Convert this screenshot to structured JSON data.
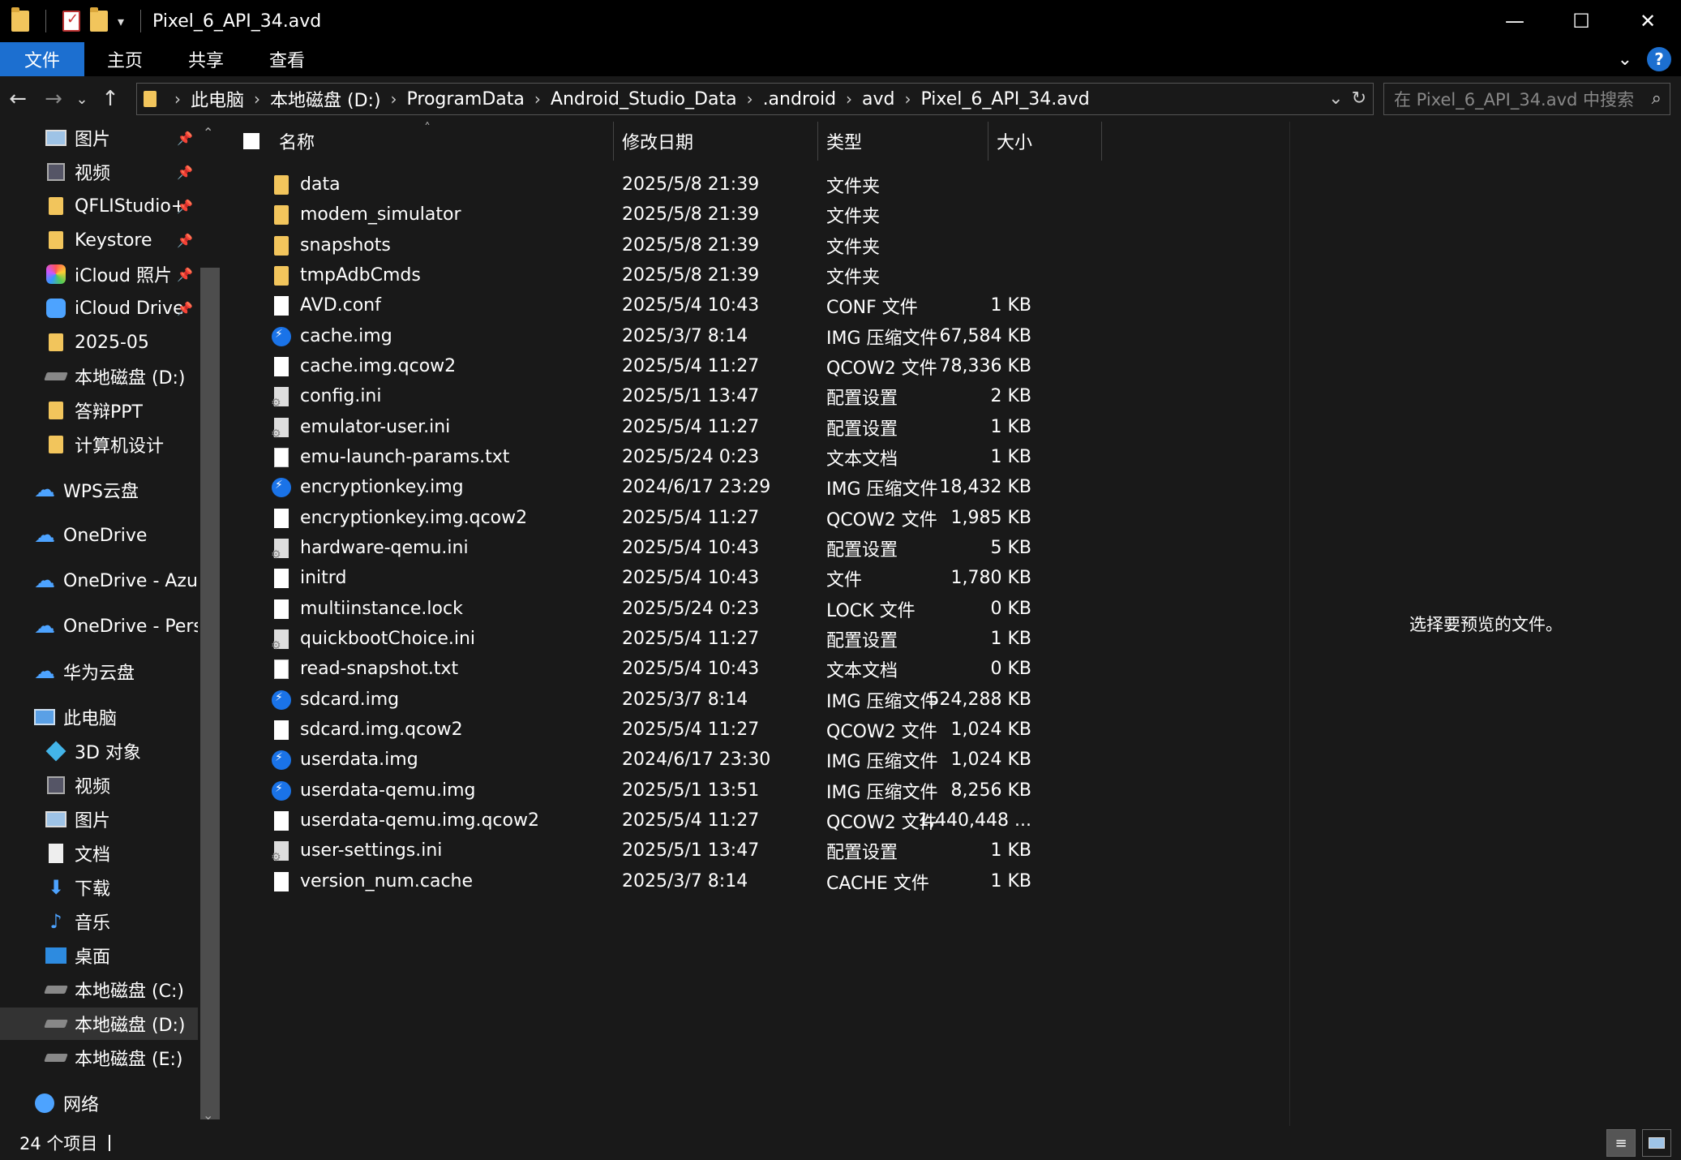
{
  "window": {
    "title": "Pixel_6_API_34.avd",
    "controls": {
      "minimize": "—",
      "maximize": "☐",
      "close": "✕"
    }
  },
  "ribbon": {
    "tabs": [
      {
        "label": "文件",
        "active": true
      },
      {
        "label": "主页",
        "active": false
      },
      {
        "label": "共享",
        "active": false
      },
      {
        "label": "查看",
        "active": false
      }
    ],
    "help": "?"
  },
  "address": {
    "breadcrumbs": [
      "此电脑",
      "本地磁盘 (D:)",
      "ProgramData",
      "Android_Studio_Data",
      ".android",
      "avd",
      "Pixel_6_API_34.avd"
    ]
  },
  "search": {
    "placeholder": "在 Pixel_6_API_34.avd 中搜索"
  },
  "nav": {
    "items": [
      {
        "label": "图片",
        "icon": "pictures-icon",
        "pinned": true
      },
      {
        "label": "视频",
        "icon": "video-icon",
        "pinned": true
      },
      {
        "label": "QFLIStudio+",
        "icon": "folder-icon",
        "pinned": true
      },
      {
        "label": "Keystore",
        "icon": "folder-icon",
        "pinned": true
      },
      {
        "label": "iCloud 照片",
        "icon": "icloud-photos-icon",
        "pinned": true
      },
      {
        "label": "iCloud Drive",
        "icon": "icloud-drive-icon",
        "pinned": true
      },
      {
        "label": "2025-05",
        "icon": "folder-icon",
        "pinned": false
      },
      {
        "label": "本地磁盘 (D:)",
        "icon": "drive-icon",
        "pinned": false
      },
      {
        "label": "答辩PPT",
        "icon": "folder-icon",
        "pinned": false
      },
      {
        "label": "计算机设计",
        "icon": "folder-icon",
        "pinned": false
      },
      {
        "label": "WPS云盘",
        "icon": "wps-cloud-icon",
        "pinned": false
      },
      {
        "label": "OneDrive",
        "icon": "onedrive-icon",
        "pinned": false
      },
      {
        "label": "OneDrive - Azure",
        "icon": "onedrive-icon",
        "pinned": false
      },
      {
        "label": "OneDrive - Perso",
        "icon": "onedrive-icon",
        "pinned": false
      },
      {
        "label": "华为云盘",
        "icon": "huawei-cloud-icon",
        "pinned": false
      },
      {
        "label": "此电脑",
        "icon": "this-pc-icon",
        "pinned": false
      },
      {
        "label": "3D 对象",
        "icon": "3d-objects-icon",
        "pinned": false
      },
      {
        "label": "视频",
        "icon": "video-icon",
        "pinned": false
      },
      {
        "label": "图片",
        "icon": "pictures-icon",
        "pinned": false
      },
      {
        "label": "文档",
        "icon": "documents-icon",
        "pinned": false
      },
      {
        "label": "下载",
        "icon": "download-icon",
        "pinned": false
      },
      {
        "label": "音乐",
        "icon": "music-icon",
        "pinned": false
      },
      {
        "label": "桌面",
        "icon": "desktop-icon",
        "pinned": false
      },
      {
        "label": "本地磁盘 (C:)",
        "icon": "drive-icon",
        "pinned": false
      },
      {
        "label": "本地磁盘 (D:)",
        "icon": "drive-icon",
        "pinned": false,
        "selected": true
      },
      {
        "label": "本地磁盘 (E:)",
        "icon": "drive-icon",
        "pinned": false
      },
      {
        "label": "网络",
        "icon": "network-icon",
        "pinned": false
      }
    ]
  },
  "columns": {
    "name": "名称",
    "date": "修改日期",
    "type": "类型",
    "size": "大小"
  },
  "files": [
    {
      "name": "data",
      "date": "2025/5/8 21:39",
      "type": "文件夹",
      "size": "",
      "icon": "folder"
    },
    {
      "name": "modem_simulator",
      "date": "2025/5/8 21:39",
      "type": "文件夹",
      "size": "",
      "icon": "folder"
    },
    {
      "name": "snapshots",
      "date": "2025/5/8 21:39",
      "type": "文件夹",
      "size": "",
      "icon": "folder"
    },
    {
      "name": "tmpAdbCmds",
      "date": "2025/5/8 21:39",
      "type": "文件夹",
      "size": "",
      "icon": "folder"
    },
    {
      "name": "AVD.conf",
      "date": "2025/5/4 10:43",
      "type": "CONF 文件",
      "size": "1 KB",
      "icon": "file"
    },
    {
      "name": "cache.img",
      "date": "2025/3/7 8:14",
      "type": "IMG 压缩文件",
      "size": "67,584 KB",
      "icon": "img"
    },
    {
      "name": "cache.img.qcow2",
      "date": "2025/5/4 11:27",
      "type": "QCOW2 文件",
      "size": "78,336 KB",
      "icon": "file"
    },
    {
      "name": "config.ini",
      "date": "2025/5/1 13:47",
      "type": "配置设置",
      "size": "2 KB",
      "icon": "ini"
    },
    {
      "name": "emulator-user.ini",
      "date": "2025/5/4 11:27",
      "type": "配置设置",
      "size": "1 KB",
      "icon": "ini"
    },
    {
      "name": "emu-launch-params.txt",
      "date": "2025/5/24 0:23",
      "type": "文本文档",
      "size": "1 KB",
      "icon": "txt"
    },
    {
      "name": "encryptionkey.img",
      "date": "2024/6/17 23:29",
      "type": "IMG 压缩文件",
      "size": "18,432 KB",
      "icon": "img"
    },
    {
      "name": "encryptionkey.img.qcow2",
      "date": "2025/5/4 11:27",
      "type": "QCOW2 文件",
      "size": "1,985 KB",
      "icon": "file"
    },
    {
      "name": "hardware-qemu.ini",
      "date": "2025/5/4 10:43",
      "type": "配置设置",
      "size": "5 KB",
      "icon": "ini"
    },
    {
      "name": "initrd",
      "date": "2025/5/4 10:43",
      "type": "文件",
      "size": "1,780 KB",
      "icon": "file"
    },
    {
      "name": "multiinstance.lock",
      "date": "2025/5/24 0:23",
      "type": "LOCK 文件",
      "size": "0 KB",
      "icon": "file"
    },
    {
      "name": "quickbootChoice.ini",
      "date": "2025/5/4 11:27",
      "type": "配置设置",
      "size": "1 KB",
      "icon": "ini"
    },
    {
      "name": "read-snapshot.txt",
      "date": "2025/5/4 10:43",
      "type": "文本文档",
      "size": "0 KB",
      "icon": "txt"
    },
    {
      "name": "sdcard.img",
      "date": "2025/3/7 8:14",
      "type": "IMG 压缩文件",
      "size": "524,288 KB",
      "icon": "img"
    },
    {
      "name": "sdcard.img.qcow2",
      "date": "2025/5/4 11:27",
      "type": "QCOW2 文件",
      "size": "1,024 KB",
      "icon": "file"
    },
    {
      "name": "userdata.img",
      "date": "2024/6/17 23:30",
      "type": "IMG 压缩文件",
      "size": "1,024 KB",
      "icon": "img"
    },
    {
      "name": "userdata-qemu.img",
      "date": "2025/5/1 13:51",
      "type": "IMG 压缩文件",
      "size": "8,256 KB",
      "icon": "img"
    },
    {
      "name": "userdata-qemu.img.qcow2",
      "date": "2025/5/4 11:27",
      "type": "QCOW2 文件",
      "size": "1,440,448 ...",
      "icon": "file"
    },
    {
      "name": "user-settings.ini",
      "date": "2025/5/1 13:47",
      "type": "配置设置",
      "size": "1 KB",
      "icon": "ini"
    },
    {
      "name": "version_num.cache",
      "date": "2025/3/7 8:14",
      "type": "CACHE 文件",
      "size": "1 KB",
      "icon": "file"
    }
  ],
  "preview": {
    "message": "选择要预览的文件。"
  },
  "status": {
    "count": "24 个项目"
  }
}
